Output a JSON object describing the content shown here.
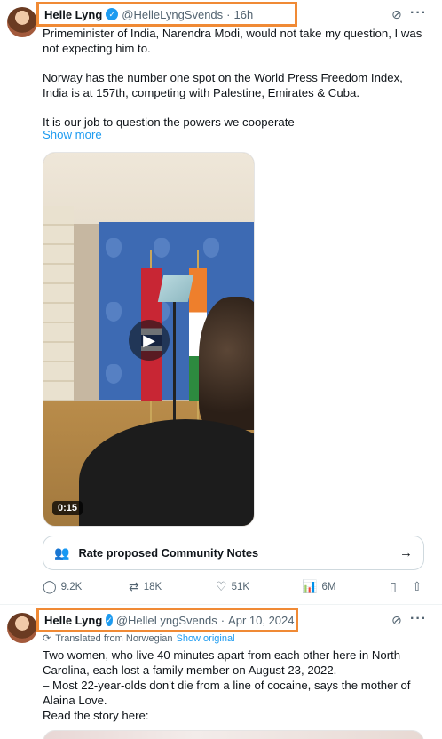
{
  "tweet1": {
    "author_name": "Helle Lyng",
    "handle": "@HelleLyngSvends",
    "separator": "·",
    "time": "16h",
    "text_lines": [
      "Primeminister of India, Narendra Modi, would not take my question, I was not expecting him to.",
      "Norway has the number one spot on the World Press Freedom Index, India is at 157th, competing with Palestine, Emirates & Cuba.",
      "It is our job to question the powers we cooperate"
    ],
    "show_more": "Show more",
    "video_duration": "0:15",
    "community_notes_label": "Rate proposed Community Notes",
    "actions": {
      "replies": "9.2K",
      "reposts": "18K",
      "likes": "51K",
      "views": "6M"
    }
  },
  "tweet2": {
    "author_name": "Helle Lyng",
    "handle": "@HelleLyngSvends",
    "separator": "·",
    "time": "Apr 10, 2024",
    "translated_label": "Translated from Norwegian",
    "show_original": "Show original",
    "text_lines": [
      "Two women, who live 40 minutes apart from each other here in North Carolina, each lost a family member on August 23, 2022.",
      "– Most 22-year-olds don't die from a line of cocaine, says the mother of Alaina Love.",
      "Read the story here:"
    ]
  },
  "icons": {
    "verified": "verified-badge-icon",
    "grok": "grok-icon",
    "more": "more-icon",
    "reply": "reply-icon",
    "repost": "repost-icon",
    "like": "like-icon",
    "views": "views-icon",
    "bookmark": "bookmark-icon",
    "share": "share-icon"
  },
  "colors": {
    "accent": "#1d9bf0",
    "highlight_border": "#f08a35",
    "secondary_text": "#536471"
  }
}
